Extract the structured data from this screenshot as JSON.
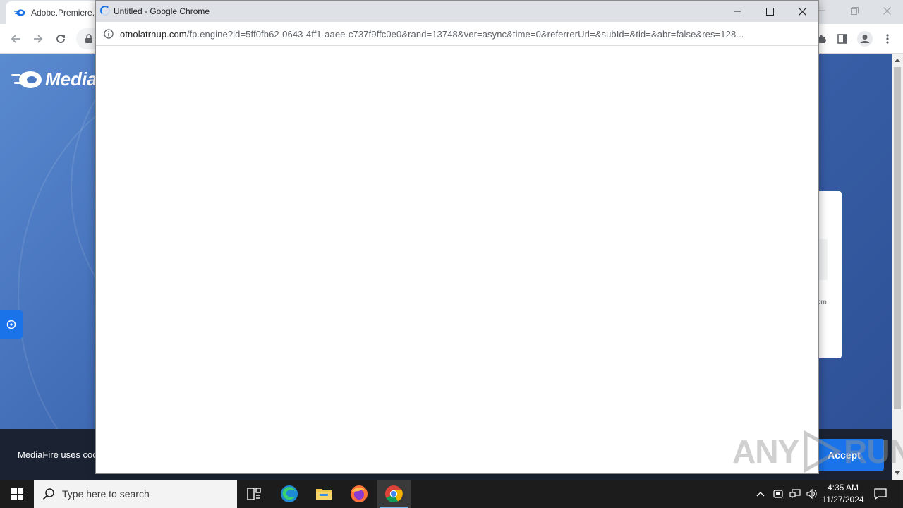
{
  "background_window": {
    "tab_title": "Adobe.Premiere.P",
    "page": {
      "logo_text": "Media",
      "card_text": "om",
      "cookie_text": "MediaFire uses coo",
      "accept_label": "Accept"
    }
  },
  "popup": {
    "title": "Untitled - Google Chrome",
    "url_host": "otnolatrnup.com",
    "url_path": "/fp.engine?id=5ff0fb62-0643-4ff1-aaee-c737f9ffc0e0&rand=13748&ver=async&time=0&referrerUrl=&subId=&tid=&abr=false&res=128..."
  },
  "watermark": {
    "left": "ANY",
    "right": "RUN"
  },
  "taskbar": {
    "search_placeholder": "Type here to search",
    "clock_time": "4:35 AM",
    "clock_date": "11/27/2024",
    "icons": [
      "task-view-icon",
      "edge-icon",
      "file-explorer-icon",
      "firefox-icon",
      "chrome-icon"
    ]
  },
  "colors": {
    "accent": "#1a73e8",
    "taskbar": "#1c1c1c",
    "page_gradient_start": "#5a8ad0",
    "page_gradient_end": "#2d4f94"
  }
}
